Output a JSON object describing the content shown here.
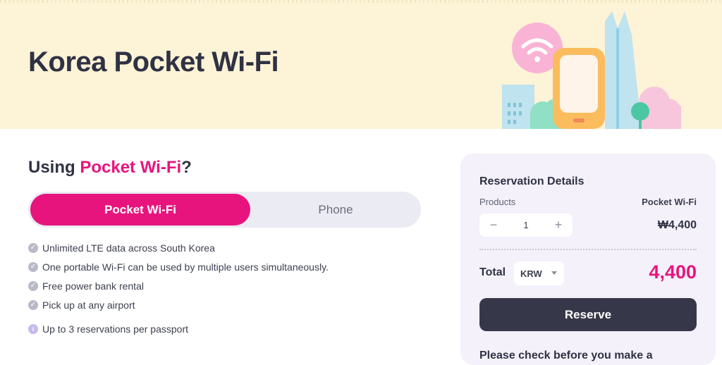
{
  "hero": {
    "title": "Korea Pocket Wi-Fi"
  },
  "section": {
    "prefix": "Using ",
    "accent": "Pocket Wi-Fi",
    "suffix": "?"
  },
  "toggle": {
    "options": [
      {
        "label": "Pocket Wi-Fi",
        "active": true
      },
      {
        "label": "Phone",
        "active": false
      }
    ]
  },
  "features": [
    "Unlimited LTE data across South Korea",
    "One portable Wi-Fi can be used by multiple users simultaneously.",
    "Free power bank rental",
    "Pick up at any airport"
  ],
  "info_note": "Up to 3 reservations per passport",
  "reservation": {
    "title": "Reservation Details",
    "products_label": "Products",
    "product_name": "Pocket Wi-Fi",
    "quantity": "1",
    "price": "₩4,400",
    "total_label": "Total",
    "currency": "KRW",
    "total_amount": "4,400",
    "reserve_label": "Reserve",
    "note": "Please check before you make a"
  },
  "colors": {
    "accent": "#e8147e",
    "hero_bg": "#fdf3d6",
    "card_bg": "#f4f1fb",
    "button_dark": "#363849"
  },
  "icons": [
    "wifi-icon",
    "phone-icon",
    "check-icon",
    "info-icon",
    "minus-icon",
    "plus-icon",
    "caret-down-icon"
  ]
}
